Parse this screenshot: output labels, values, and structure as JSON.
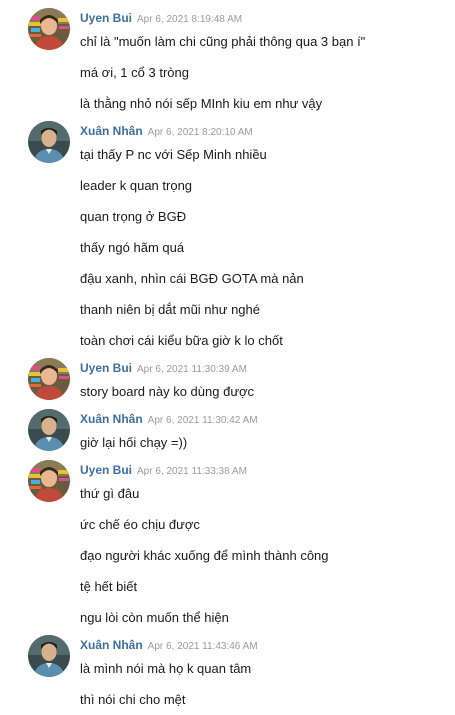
{
  "messages": [
    {
      "name": "Uyen Bui",
      "time": "Apr 6, 2021 8:19:48 AM",
      "avatar": "uyen",
      "lines": [
        "chỉ là \"muốn làm chi cũng phải thông qua 3 bạn í\"",
        "má ơi, 1 cổ 3 tròng",
        "là thằng nhỏ nói sếp MInh kiu em như vậy"
      ]
    },
    {
      "name": "Xuân Nhân",
      "time": "Apr 6, 2021 8:20:10 AM",
      "avatar": "nhan",
      "lines": [
        "tại thấy P nc với Sếp Minh nhiều",
        "leader k quan trọng",
        "quan trọng ở BGĐ",
        "thấy ngó hãm quá",
        "đậu xanh, nhìn cái BGĐ GOTA mà nản",
        "thanh niên bị dắt mũi như nghé",
        "toàn chơi cái kiểu bữa giờ k lo chốt"
      ]
    },
    {
      "name": "Uyen Bui",
      "time": "Apr 6, 2021 11:30:39 AM",
      "avatar": "uyen",
      "lines": [
        "story board này ko dùng được"
      ]
    },
    {
      "name": "Xuân Nhân",
      "time": "Apr 6, 2021 11:30:42 AM",
      "avatar": "nhan",
      "lines": [
        "giờ lại hối chạy =))"
      ]
    },
    {
      "name": "Uyen Bui",
      "time": "Apr 6, 2021 11:33:38 AM",
      "avatar": "uyen",
      "lines": [
        "thứ gì đâu",
        "ức chế éo chịu được",
        "đạo người khác xuống để mình thành công",
        "tệ hết biết",
        "ngu lòi còn muốn thể hiện"
      ]
    },
    {
      "name": "Xuân Nhân",
      "time": "Apr 6, 2021 11:43:46 AM",
      "avatar": "nhan",
      "lines": [
        "là mình nói mà họ k quan tâm",
        "thì nói chi cho mệt"
      ]
    }
  ]
}
